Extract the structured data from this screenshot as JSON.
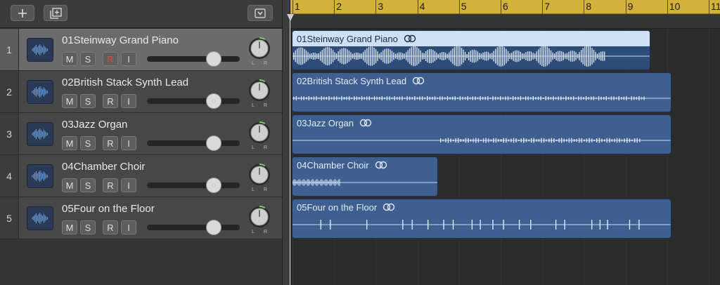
{
  "toolbar": {
    "add_icon": "plus-icon",
    "duplicate_icon": "duplicate-track-icon",
    "menu_icon": "chevron-down-box-icon"
  },
  "ruler": {
    "bars": [
      "1",
      "2",
      "3",
      "4",
      "5",
      "6",
      "7",
      "8",
      "9",
      "10",
      "11"
    ]
  },
  "tracks": [
    {
      "number": "1",
      "name": "01Steinway Grand Piano",
      "mute": "M",
      "solo": "S",
      "record": "R",
      "input": "I",
      "record_armed": true,
      "volume": 0.72,
      "selected": true,
      "pan_l": "L",
      "pan_r": "R",
      "region_label": "01Steinway Grand Piano",
      "region_end_bar": 9.6,
      "icon": "waveform-icon"
    },
    {
      "number": "2",
      "name": "02British Stack Synth Lead",
      "mute": "M",
      "solo": "S",
      "record": "R",
      "input": "I",
      "record_armed": false,
      "volume": 0.72,
      "selected": false,
      "pan_l": "L",
      "pan_r": "R",
      "region_label": "02British Stack Synth Lead",
      "region_end_bar": 10.1,
      "icon": "waveform-icon"
    },
    {
      "number": "3",
      "name": "03Jazz Organ",
      "mute": "M",
      "solo": "S",
      "record": "R",
      "input": "I",
      "record_armed": false,
      "volume": 0.72,
      "selected": false,
      "pan_l": "L",
      "pan_r": "R",
      "region_label": "03Jazz Organ",
      "region_end_bar": 10.1,
      "icon": "waveform-icon"
    },
    {
      "number": "4",
      "name": "04Chamber Choir",
      "mute": "M",
      "solo": "S",
      "record": "R",
      "input": "I",
      "record_armed": false,
      "volume": 0.72,
      "selected": false,
      "pan_l": "L",
      "pan_r": "R",
      "region_label": "04Chamber Choir",
      "region_end_bar": 4.5,
      "icon": "waveform-icon"
    },
    {
      "number": "5",
      "name": "05Four on the Floor",
      "mute": "M",
      "solo": "S",
      "record": "R",
      "input": "I",
      "record_armed": false,
      "volume": 0.72,
      "selected": false,
      "pan_l": "L",
      "pan_r": "R",
      "region_label": "05Four on the Floor",
      "region_end_bar": 10.1,
      "icon": "waveform-icon"
    }
  ],
  "colors": {
    "ruler": "#d4b13b",
    "region": "#3e5f8f",
    "region_selected_header": "#cfe0f5",
    "record_armed": "#e04a3a"
  }
}
